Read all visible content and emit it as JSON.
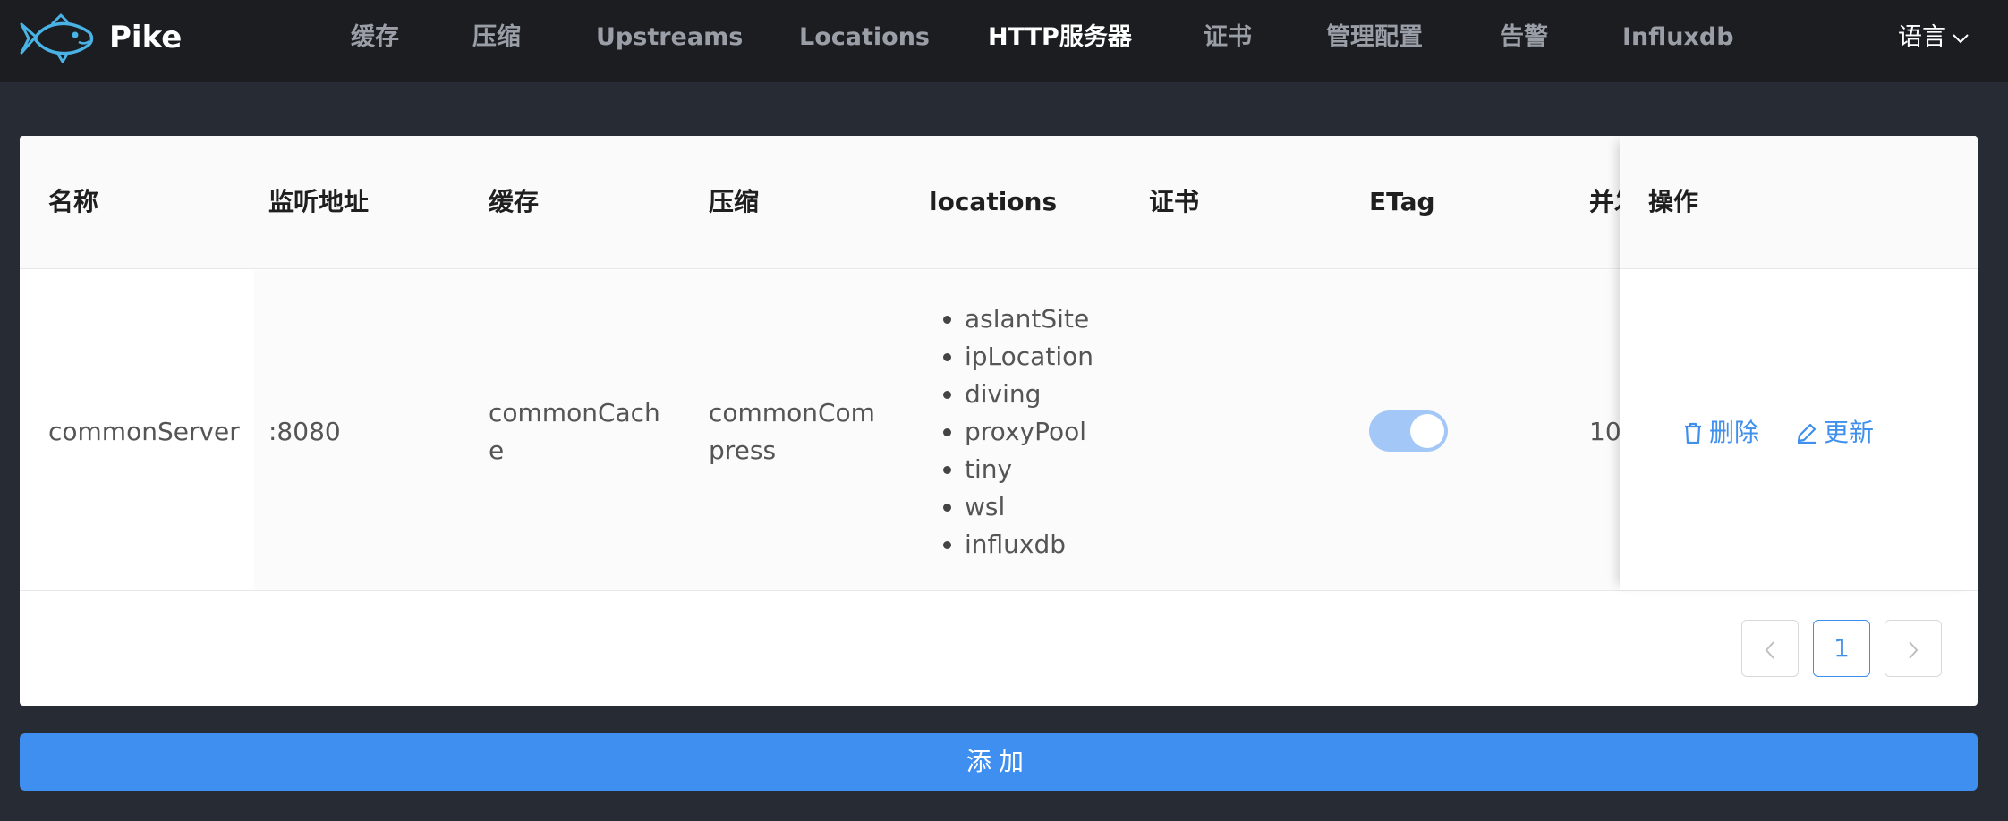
{
  "app": {
    "brand": "Pike",
    "language_label": "语言"
  },
  "nav": {
    "items": [
      {
        "label": "缓存"
      },
      {
        "label": "压缩"
      },
      {
        "label": "Upstreams"
      },
      {
        "label": "Locations"
      },
      {
        "label": "HTTP服务器",
        "active": true
      },
      {
        "label": "证书"
      },
      {
        "label": "管理配置"
      },
      {
        "label": "告警"
      },
      {
        "label": "Influxdb"
      }
    ]
  },
  "table": {
    "headers": [
      "名称",
      "监听地址",
      "缓存",
      "压缩",
      "locations",
      "证书",
      "ETag",
      "并发",
      "操作"
    ],
    "rows": [
      {
        "name": "commonServer",
        "addr": ":8080",
        "cache_line1": "commonCach",
        "cache_line2": "e",
        "compress_line1": "commonCom",
        "compress_line2": "press",
        "locations": [
          "aslantSite",
          "ipLocation",
          "diving",
          "proxyPool",
          "tiny",
          "wsl",
          "influxdb"
        ],
        "cert": "",
        "etag": true,
        "concurrency": "10",
        "actions": {
          "delete": "删除",
          "update": "更新"
        }
      }
    ]
  },
  "pagination": {
    "prev": "<",
    "current": "1",
    "next": ">"
  },
  "add_button": "添加",
  "colors": {
    "accent": "#3f8fec",
    "header_bg": "#1b1d21",
    "page_bg": "#272b34",
    "toggle_on": "#a3c8f7"
  }
}
